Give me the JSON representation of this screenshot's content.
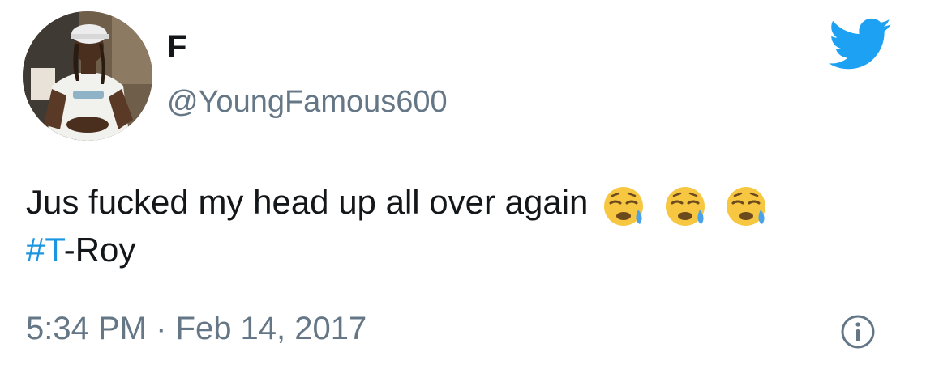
{
  "author": {
    "display_name": "F",
    "handle": "@YoungFamous600",
    "avatar_icon": "profile-photo"
  },
  "tweet": {
    "text_before_emoji": "Jus fucked my head up all over again",
    "emojis": [
      "sad-relieved-face",
      "sad-relieved-face",
      "sad-relieved-face"
    ],
    "hashtag": "#T",
    "text_after_hashtag": "-Roy"
  },
  "meta": {
    "timestamp": "5:34 PM · Feb 14, 2017"
  },
  "icons": {
    "brand": "twitter-bird-icon",
    "info": "info-icon"
  },
  "colors": {
    "brand_blue": "#1da1f2",
    "hashtag_blue": "#1b95e0",
    "secondary_text": "#657786",
    "primary_text": "#14171a"
  }
}
